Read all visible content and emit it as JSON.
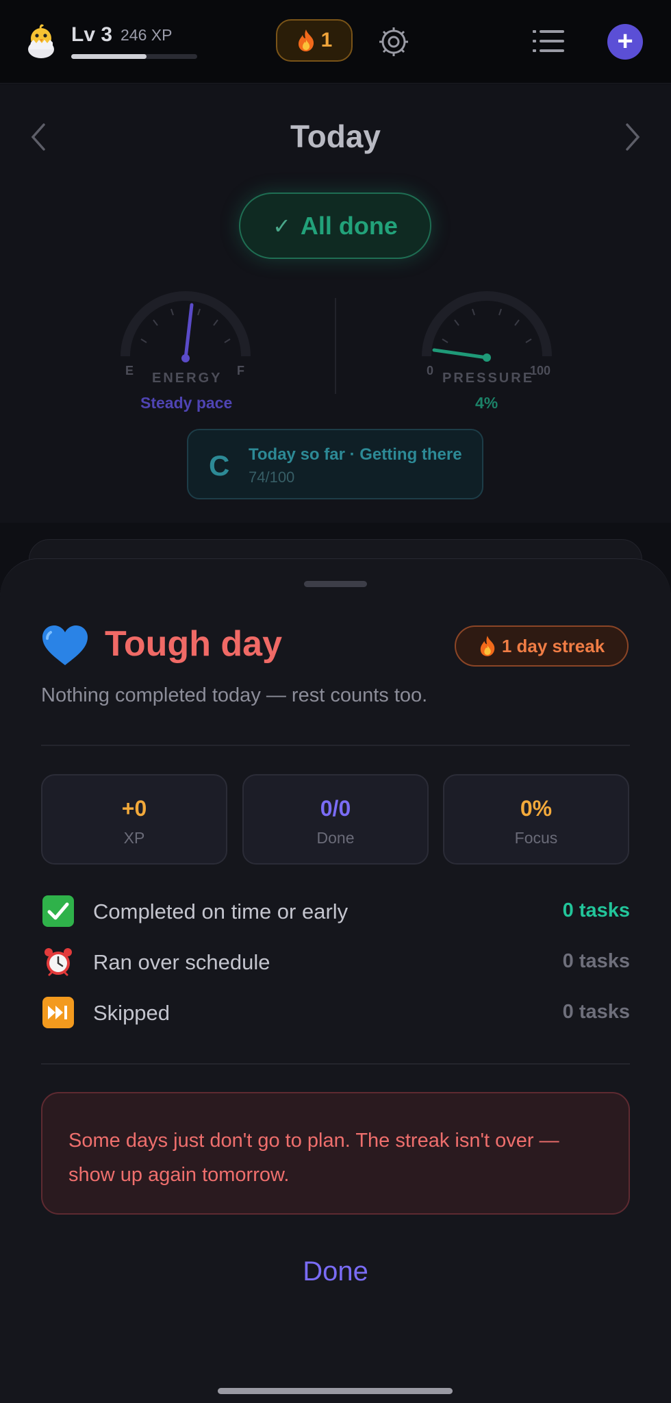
{
  "header": {
    "level": "Lv 3",
    "xp": "246 XP",
    "xp_progress": 0.6,
    "streak_count": "1"
  },
  "background": {
    "date_title": "Today",
    "status": "All done",
    "energy": {
      "label": "ENERGY",
      "left": "E",
      "right": "F",
      "caption": "Steady pace",
      "color": "#5a4bc8"
    },
    "pressure": {
      "label": "PRESSURE",
      "left": "0",
      "right": "100",
      "caption": "4%",
      "value": 4,
      "color": "#1f9a78"
    },
    "score": {
      "grade": "C",
      "title": "Today so far · Getting there",
      "value": "74/100"
    }
  },
  "sheet": {
    "title": "Tough day",
    "streak": "1 day streak",
    "subtitle": "Nothing completed today — rest counts too.",
    "stats": [
      {
        "value": "+0",
        "label": "XP",
        "color": "#f2a93b"
      },
      {
        "value": "0/0",
        "label": "Done",
        "color": "#7a6cf5"
      },
      {
        "value": "0%",
        "label": "Focus",
        "color": "#f2a93b"
      }
    ],
    "rows": [
      {
        "label": "Completed on time or early",
        "value": "0 tasks",
        "color": "#22c59a",
        "icon": "check-icon"
      },
      {
        "label": "Ran over schedule",
        "value": "0 tasks",
        "color": "#6e6f7b",
        "icon": "alarm-clock-icon"
      },
      {
        "label": "Skipped",
        "value": "0 tasks",
        "color": "#6e6f7b",
        "icon": "fast-forward-icon"
      }
    ],
    "message": "Some days just don't go to plan. The streak isn't over — show up again tomorrow.",
    "done_label": "Done"
  }
}
